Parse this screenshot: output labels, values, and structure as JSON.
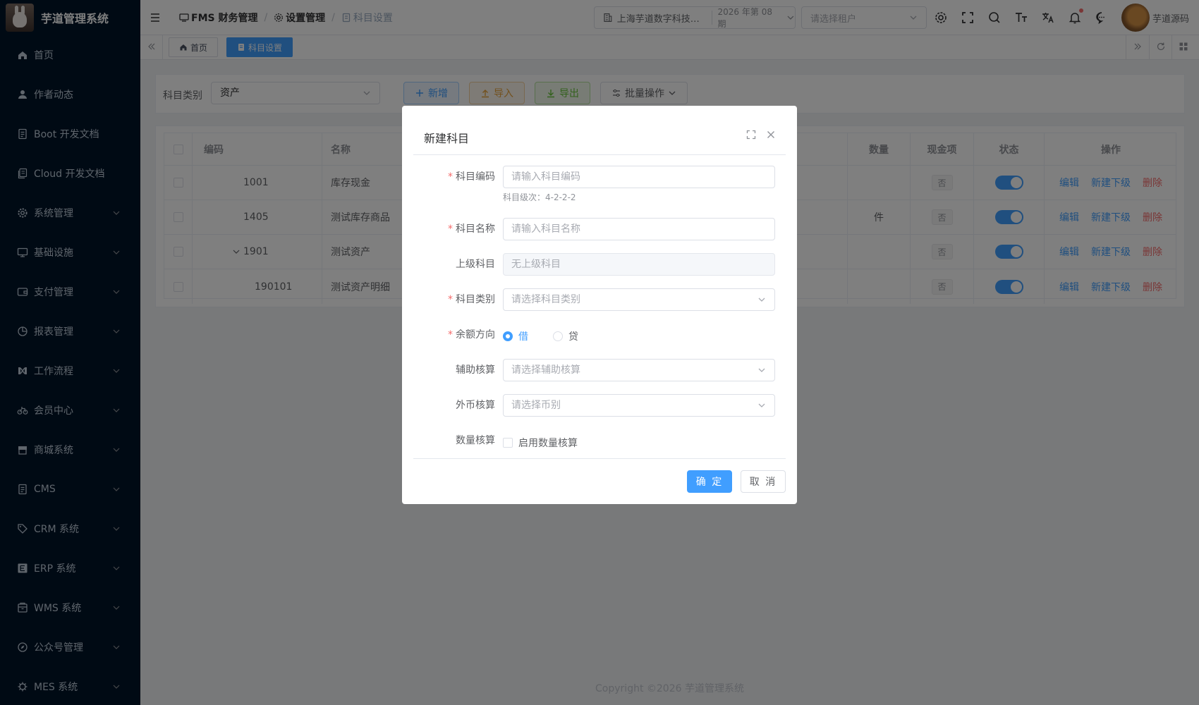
{
  "app": {
    "title": "芋道管理系统",
    "copyright": "Copyright ©2026 芋道管理系统"
  },
  "sidebar": {
    "items": [
      {
        "label": "首页",
        "icon": "home-icon"
      },
      {
        "label": "作者动态",
        "icon": "user-icon"
      },
      {
        "label": "Boot 开发文档",
        "icon": "document-icon"
      },
      {
        "label": "Cloud 开发文档",
        "icon": "documents-icon"
      },
      {
        "label": "系统管理",
        "icon": "gear-icon",
        "expandable": true
      },
      {
        "label": "基础设施",
        "icon": "monitor-icon",
        "expandable": true
      },
      {
        "label": "支付管理",
        "icon": "wallet-icon",
        "expandable": true
      },
      {
        "label": "报表管理",
        "icon": "pie-chart-icon",
        "expandable": true
      },
      {
        "label": "工作流程",
        "icon": "flow-icon",
        "expandable": true
      },
      {
        "label": "会员中心",
        "icon": "bicycle-icon",
        "expandable": true
      },
      {
        "label": "商城系统",
        "icon": "shop-icon",
        "expandable": true
      },
      {
        "label": "CMS",
        "icon": "document-icon",
        "expandable": true
      },
      {
        "label": "CRM 系统",
        "icon": "tag-icon",
        "expandable": true
      },
      {
        "label": "ERP 系统",
        "icon": "erp-icon",
        "expandable": true
      },
      {
        "label": "WMS 系统",
        "icon": "box-icon",
        "expandable": true
      },
      {
        "label": "公众号管理",
        "icon": "compass-icon",
        "expandable": true
      },
      {
        "label": "MES 系统",
        "icon": "cog-icon",
        "expandable": true
      }
    ]
  },
  "header": {
    "breadcrumb": [
      "FMS 财务管理",
      "设置管理",
      "科目设置"
    ],
    "tenant_name": "上海芋道数字科技有限公司",
    "period": "2026 年第 08 期",
    "tenant_placeholder": "请选择租户",
    "user_name": "芋道源码"
  },
  "tabs": [
    {
      "label": "首页"
    },
    {
      "label": "科目设置",
      "active": true
    }
  ],
  "search": {
    "label": "科目类别",
    "value": "资产"
  },
  "toolbar": {
    "new": "新增",
    "import": "导入",
    "export": "导出",
    "batch": "批量操作"
  },
  "table": {
    "headers": {
      "code": "编码",
      "name": "名称",
      "quantity": "数量",
      "cash": "现金项",
      "status": "状态",
      "actions": "操作"
    },
    "rows": [
      {
        "code": "1001",
        "name": "库存现金",
        "quantity": "",
        "cash": "否",
        "status": true
      },
      {
        "code": "1405",
        "name": "测试库存商品",
        "quantity": "件",
        "cash": "否",
        "status": true
      },
      {
        "code": "1901",
        "name": "测试资产",
        "quantity": "",
        "cash": "否",
        "status": true,
        "expanded": true
      },
      {
        "code": "190101",
        "name": "测试资产明细",
        "quantity": "",
        "cash": "否",
        "status": true,
        "child": true
      }
    ],
    "actions": {
      "edit": "编辑",
      "add_child": "新建下级",
      "delete": "删除"
    }
  },
  "dialog": {
    "title": "新建科目",
    "fields": {
      "code_label": "科目编码",
      "code_placeholder": "请输入科目编码",
      "code_hint": "科目级次：4-2-2-2",
      "name_label": "科目名称",
      "name_placeholder": "请输入科目名称",
      "parent_label": "上级科目",
      "parent_value": "无上级科目",
      "type_label": "科目类别",
      "type_placeholder": "请选择科目类别",
      "direction_label": "余额方向",
      "direction_debit": "借",
      "direction_credit": "贷",
      "direction_selected": "借",
      "aux_label": "辅助核算",
      "aux_placeholder": "请选择辅助核算",
      "fx_label": "外币核算",
      "fx_placeholder": "请选择币别",
      "qty_label": "数量核算",
      "qty_checkbox": "启用数量核算"
    },
    "ok": "确 定",
    "cancel": "取 消"
  },
  "colors": {
    "primary": "#409eff",
    "danger": "#f56c6c",
    "sidebar_bg": "#001529"
  }
}
